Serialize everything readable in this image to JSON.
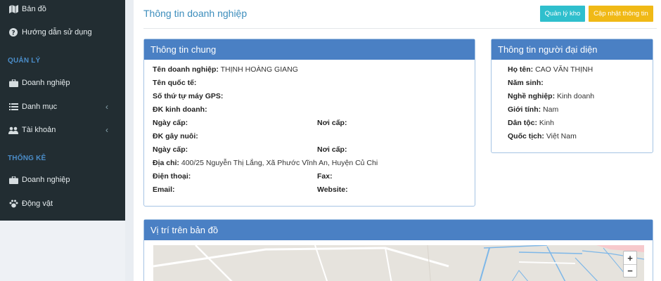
{
  "sidebar": {
    "items_top": [
      {
        "icon": "map-icon",
        "label": "Bản đồ"
      },
      {
        "icon": "question-circle-icon",
        "label": "Hướng dẫn sử dụng"
      }
    ],
    "section_manage": "QUẢN LÝ",
    "manage_items": [
      {
        "icon": "briefcase-icon",
        "label": "Doanh nghiệp"
      },
      {
        "icon": "list-icon",
        "label": "Danh mục"
      },
      {
        "icon": "users-icon",
        "label": "Tài khoản"
      }
    ],
    "section_stats": "THỐNG KÊ",
    "stats_items": [
      {
        "icon": "briefcase-icon",
        "label": "Doanh nghiệp"
      },
      {
        "icon": "paw-icon",
        "label": "Động vật"
      }
    ]
  },
  "header": {
    "title": "Thông tin doanh nghiệp",
    "btn_warehouse": "Quản lý kho",
    "btn_update": "Cập nhật thông tin"
  },
  "general": {
    "title": "Thông tin chung",
    "company_name_label": "Tên doanh nghiệp:",
    "company_name": "THỊNH HOÀNG GIANG",
    "intl_name_label": "Tên quốc tế:",
    "gps_label": "Số thứ tự máy GPS:",
    "business_reg_label": "ĐK kinh doanh:",
    "issue_date_label": "Ngày cấp:",
    "issue_place_label": "Nơi cấp:",
    "breeding_reg_label": "ĐK gây nuôi:",
    "issue_date2_label": "Ngày cấp:",
    "issue_place2_label": "Nơi cấp:",
    "address_label": "Địa chỉ:",
    "address": "400/25 Nguyễn Thị Lắng, Xã Phước Vĩnh An, Huyện Củ Chi",
    "phone_label": "Điện thoại:",
    "fax_label": "Fax:",
    "email_label": "Email:",
    "website_label": "Website:"
  },
  "representative": {
    "title": "Thông tin người đại diện",
    "name_label": "Họ tên:",
    "name": "CAO VĂN THỊNH",
    "birth_year_label": "Năm sinh:",
    "occupation_label": "Nghề nghiệp:",
    "occupation": "Kinh doanh",
    "gender_label": "Giới tính:",
    "gender": "Nam",
    "ethnicity_label": "Dân tộc:",
    "ethnicity": "Kinh",
    "nationality_label": "Quốc tịch:",
    "nationality": "Việt Nam"
  },
  "map": {
    "title": "Vị trí trên bản đồ",
    "zoom_in": "+",
    "zoom_out": "−"
  }
}
